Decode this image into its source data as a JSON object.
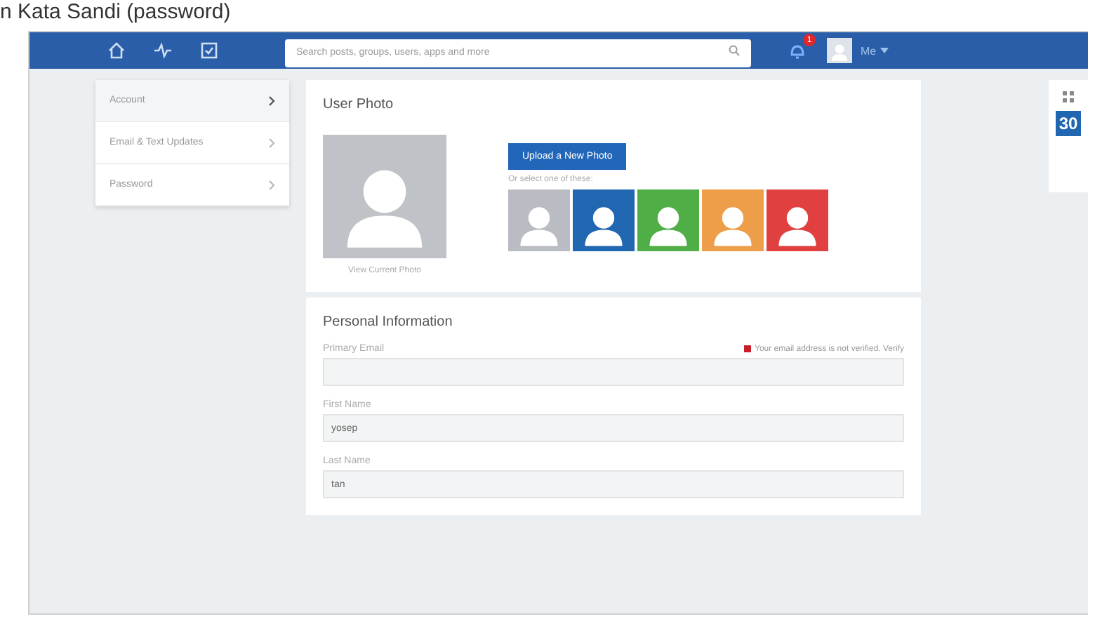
{
  "caption": "n Kata Sandi (password)",
  "navbar": {
    "search": {
      "placeholder": "Search posts, groups, users, apps and more"
    },
    "notification_count": "1",
    "user_label": "Me"
  },
  "sidebar": {
    "items": [
      {
        "label": "Account",
        "selected": true
      },
      {
        "label": "Email & Text Updates",
        "selected": false
      },
      {
        "label": "Password",
        "selected": false
      }
    ]
  },
  "user_photo": {
    "title": "User Photo",
    "current_caption": "View Current Photo",
    "upload_button": "Upload a New Photo",
    "select_hint": "Or select one of these:",
    "avatars": [
      {
        "color": "#b9bcc2"
      },
      {
        "color": "#2166b0"
      },
      {
        "color": "#4fae45"
      },
      {
        "color": "#ee9d48"
      },
      {
        "color": "#e0403f"
      }
    ]
  },
  "personal_information": {
    "title": "Personal Information",
    "verify_notice": "Your email address is not verified. Verify",
    "fields": [
      {
        "label": "Primary Email"
      },
      {
        "label": "First Name",
        "value": "yosep"
      },
      {
        "label": "Last Name",
        "value": "tan"
      }
    ]
  },
  "widget": {
    "calendar_day": "30"
  }
}
